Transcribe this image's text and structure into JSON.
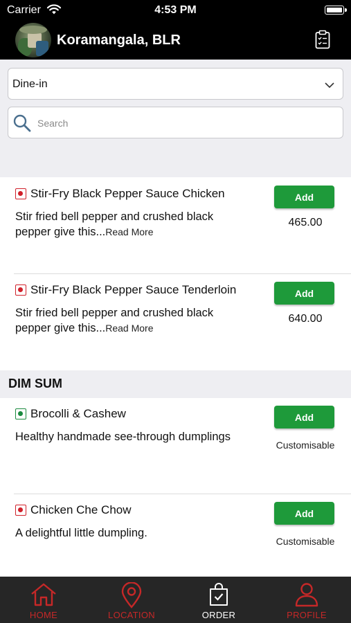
{
  "status_bar": {
    "carrier": "Carrier",
    "time": "4:53 PM"
  },
  "header": {
    "location_title": "Koramangala, BLR",
    "icons": [
      "wifi-icon",
      "battery-icon",
      "clipboard-icon"
    ]
  },
  "order_type": {
    "selected": "Dine-in"
  },
  "search": {
    "placeholder": "Search"
  },
  "items": [
    {
      "type": "non-veg",
      "name": "Stir-Fry Black Pepper Sauce Chicken",
      "desc": "Stir fried bell pepper and crushed black pepper give this...",
      "read_more": "Read More",
      "add_label": "Add",
      "price": "465.00"
    },
    {
      "type": "non-veg",
      "name": "Stir-Fry Black Pepper Sauce Tenderloin",
      "desc": "Stir fried bell pepper and crushed black pepper give this...",
      "read_more": "Read More",
      "add_label": "Add",
      "price": "640.00"
    }
  ],
  "section": {
    "title": "DIM SUM",
    "items": [
      {
        "type": "veg",
        "name": "Brocolli & Cashew",
        "desc": "Healthy handmade see-through dumplings",
        "add_label": "Add",
        "note": "Customisable"
      },
      {
        "type": "non-veg",
        "name": "Chicken Che Chow",
        "desc": "A delightful little dumpling.",
        "add_label": "Add",
        "note": "Customisable"
      }
    ]
  },
  "tabs": [
    {
      "label": "HOME",
      "icon": "home-icon",
      "active": false
    },
    {
      "label": "LOCATION",
      "icon": "location-pin-icon",
      "active": false
    },
    {
      "label": "ORDER",
      "icon": "shopping-bag-icon",
      "active": true
    },
    {
      "label": "PROFILE",
      "icon": "profile-icon",
      "active": false
    }
  ],
  "colors": {
    "accent_red": "#c62828",
    "add_green": "#1e9a3a",
    "veg_green": "#1b8a3f",
    "nonveg_red": "#d0202a",
    "tabbar_bg": "#262626",
    "header_bg": "#000000"
  }
}
